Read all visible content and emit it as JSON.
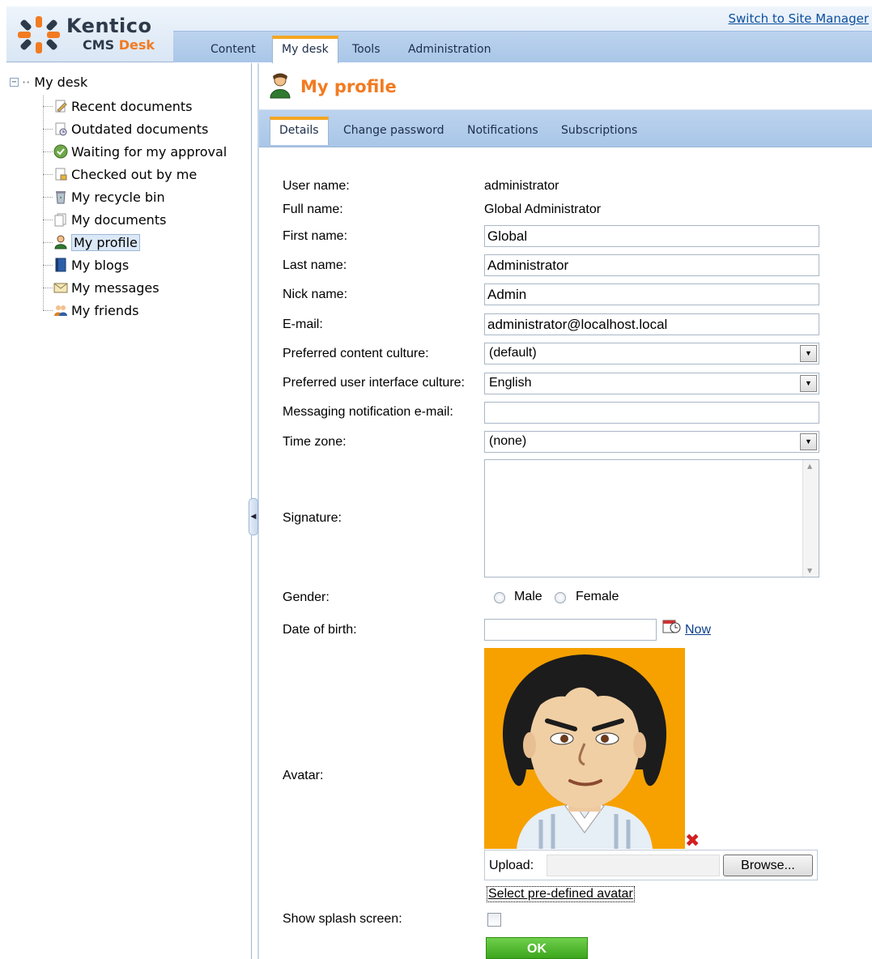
{
  "header": {
    "logo_word": "Kentico",
    "logo_cms": "CMS",
    "logo_desk": "Desk",
    "switch_link": "Switch to Site Manager",
    "tabs": [
      {
        "label": "Content"
      },
      {
        "label": "My desk",
        "active": true
      },
      {
        "label": "Tools"
      },
      {
        "label": "Administration"
      }
    ]
  },
  "tree": {
    "root_label": "My desk",
    "toggle": "−",
    "items": [
      {
        "label": "Recent documents",
        "icon": "edit-document-icon"
      },
      {
        "label": "Outdated documents",
        "icon": "outdated-document-icon"
      },
      {
        "label": "Waiting for my approval",
        "icon": "approval-check-icon"
      },
      {
        "label": "Checked out by me",
        "icon": "checked-out-document-icon"
      },
      {
        "label": "My recycle bin",
        "icon": "recycle-bin-icon"
      },
      {
        "label": "My documents",
        "icon": "documents-icon"
      },
      {
        "label": "My profile",
        "icon": "user-profile-icon",
        "selected": true
      },
      {
        "label": "My blogs",
        "icon": "blog-book-icon"
      },
      {
        "label": "My messages",
        "icon": "envelope-icon"
      },
      {
        "label": "My friends",
        "icon": "friends-icon"
      }
    ]
  },
  "page": {
    "title": "My profile",
    "tabs": [
      {
        "label": "Details",
        "active": true
      },
      {
        "label": "Change password"
      },
      {
        "label": "Notifications"
      },
      {
        "label": "Subscriptions"
      }
    ]
  },
  "form": {
    "user_name_label": "User name:",
    "user_name_value": "administrator",
    "full_name_label": "Full name:",
    "full_name_value": "Global Administrator",
    "first_name_label": "First name:",
    "first_name_value": "Global",
    "last_name_label": "Last name:",
    "last_name_value": "Administrator",
    "nick_name_label": "Nick name:",
    "nick_name_value": "Admin",
    "email_label": "E-mail:",
    "email_value": "administrator@localhost.local",
    "content_culture_label": "Preferred content culture:",
    "content_culture_value": "(default)",
    "ui_culture_label": "Preferred user interface culture:",
    "ui_culture_value": "English",
    "messaging_email_label": "Messaging notification e-mail:",
    "messaging_email_value": "",
    "time_zone_label": "Time zone:",
    "time_zone_value": "(none)",
    "signature_label": "Signature:",
    "gender_label": "Gender:",
    "gender_male": "Male",
    "gender_female": "Female",
    "dob_label": "Date of birth:",
    "dob_now": "Now",
    "avatar_label": "Avatar:",
    "upload_label": "Upload:",
    "browse_label": "Browse...",
    "predefined_avatar_link": "Select pre-defined avatar",
    "splash_label": "Show splash screen:",
    "splash_checked": false,
    "ok_label": "OK"
  },
  "colors": {
    "accent_orange": "#f27b21",
    "tab_blue": "#a9c6e8",
    "ok_green": "#3ca51d",
    "avatar_bg": "#f6a100"
  }
}
